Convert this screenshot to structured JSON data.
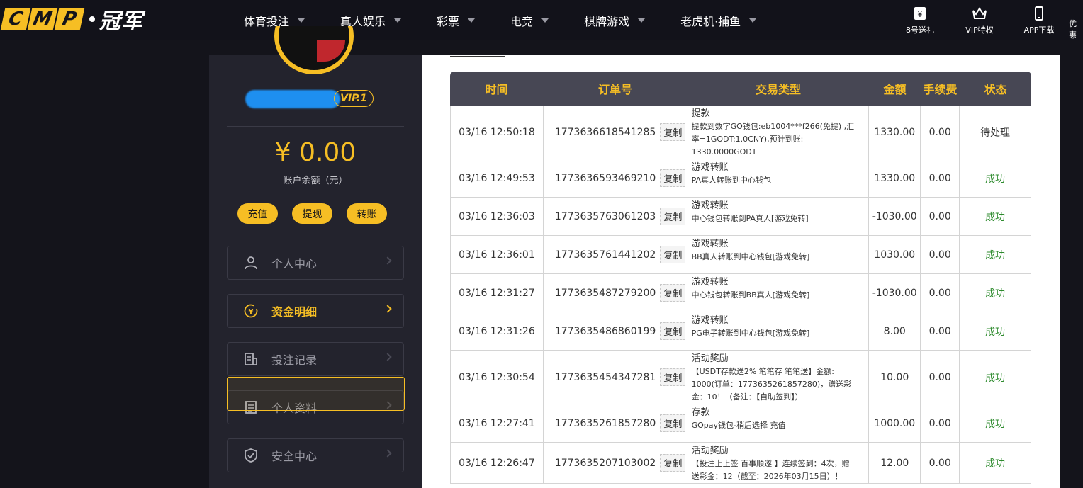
{
  "brand": {
    "letters": [
      "C",
      "M",
      "P"
    ],
    "cn": "冠军"
  },
  "nav": [
    {
      "label": "体育投注"
    },
    {
      "label": "真人娱乐"
    },
    {
      "label": "彩票"
    },
    {
      "label": "电竞"
    },
    {
      "label": "棋牌游戏"
    },
    {
      "label": "老虎机·捕鱼"
    }
  ],
  "tools": [
    {
      "label": "8号送礼",
      "icon": "gift-yen-icon"
    },
    {
      "label": "VIP特权",
      "icon": "crown-icon"
    },
    {
      "label": "APP下载",
      "icon": "phone-icon"
    },
    {
      "label": "优惠",
      "icon": "promo-icon"
    }
  ],
  "profile": {
    "vip": "VIP.1",
    "balance": "¥ 0.00",
    "balance_label": "账户余额（元）"
  },
  "actions": [
    "充值",
    "提现",
    "转账"
  ],
  "menu": [
    {
      "label": "个人中心",
      "icon": "user-icon",
      "active": false
    },
    {
      "label": "资金明细",
      "icon": "yen-cycle-icon",
      "active": true
    },
    {
      "label": "投注记录",
      "icon": "bet-record-icon",
      "active": false
    },
    {
      "label": "个人资料",
      "icon": "profile-doc-icon",
      "active": false
    },
    {
      "label": "安全中心",
      "icon": "shield-icon",
      "active": false
    }
  ],
  "table": {
    "headers": [
      "时间",
      "订单号",
      "交易类型",
      "金额",
      "手续费",
      "状态"
    ],
    "copy_label": "复制",
    "rows": [
      {
        "time": "03/16 12:50:18",
        "order": "1773636618541285",
        "type": "提款",
        "desc": [
          "提款到数字GO钱包:eb1004***f266(免提) ,汇",
          "率=1GODT:1.0CNY),预计到账:",
          "1330.0000GODT"
        ],
        "amount": "1330.00",
        "fee": "0.00",
        "status": "待处理",
        "ok": false
      },
      {
        "time": "03/16 12:49:53",
        "order": "1773636593469210",
        "type": "游戏转账",
        "desc": [
          "PA真人转账到中心钱包"
        ],
        "amount": "1330.00",
        "fee": "0.00",
        "status": "成功",
        "ok": true
      },
      {
        "time": "03/16 12:36:03",
        "order": "1773635763061203",
        "type": "游戏转账",
        "desc": [
          "中心钱包转账到PA真人[游戏免转]"
        ],
        "amount": "-1030.00",
        "fee": "0.00",
        "status": "成功",
        "ok": true
      },
      {
        "time": "03/16 12:36:01",
        "order": "1773635761441202",
        "type": "游戏转账",
        "desc": [
          "BB真人转账到中心钱包[游戏免转]"
        ],
        "amount": "1030.00",
        "fee": "0.00",
        "status": "成功",
        "ok": true
      },
      {
        "time": "03/16 12:31:27",
        "order": "1773635487279200",
        "type": "游戏转账",
        "desc": [
          "中心钱包转账到BB真人[游戏免转]"
        ],
        "amount": "-1030.00",
        "fee": "0.00",
        "status": "成功",
        "ok": true
      },
      {
        "time": "03/16 12:31:26",
        "order": "1773635486860199",
        "type": "游戏转账",
        "desc": [
          "PG电子转账到中心钱包[游戏免转]"
        ],
        "amount": "8.00",
        "fee": "0.00",
        "status": "成功",
        "ok": true
      },
      {
        "time": "03/16 12:30:54",
        "order": "1773635454347281",
        "type": "活动奖励",
        "desc": [
          "【USDT存款送2% 笔笔存 笔笔送】金额:",
          "1000(订单：1773635261857280)，赠送彩",
          "金：10！（备注：【自助签到】）"
        ],
        "amount": "10.00",
        "fee": "0.00",
        "status": "成功",
        "ok": true
      },
      {
        "time": "03/16 12:27:41",
        "order": "1773635261857280",
        "type": "存款",
        "desc": [
          "GOpay钱包-稍后选择 充值"
        ],
        "amount": "1000.00",
        "fee": "0.00",
        "status": "成功",
        "ok": true
      },
      {
        "time": "03/16 12:26:47",
        "order": "1773635207103002",
        "type": "活动奖励",
        "desc": [
          "【投注上上签 百事顺遂 】连续签到：4次，赠",
          "送彩金：12（截至：2026年03月15日）！"
        ],
        "amount": "12.00",
        "fee": "0.00",
        "status": "成功",
        "ok": true
      }
    ]
  },
  "colors": {
    "accent": "#f6be24",
    "bg": "#14141b",
    "panel": "#23232d",
    "success": "#2e8b2e"
  }
}
